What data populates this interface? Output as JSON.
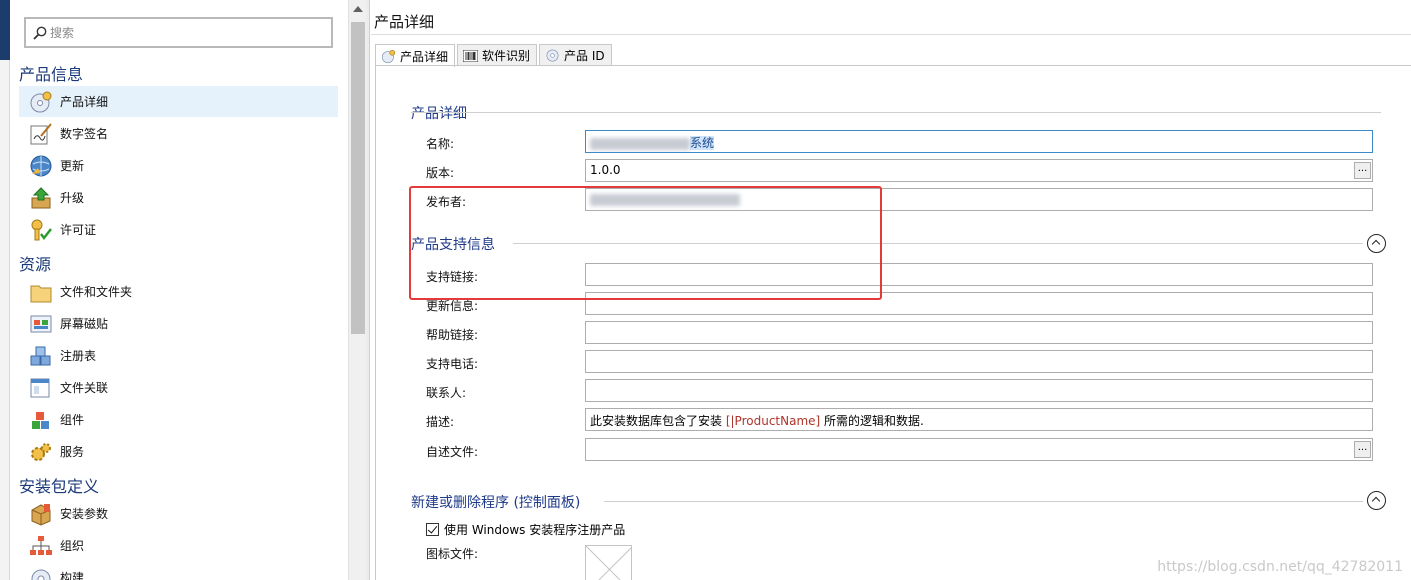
{
  "search": {
    "placeholder": "搜索"
  },
  "sidebar": {
    "groups": [
      {
        "title": "产品信息",
        "items": [
          "产品详细",
          "数字签名",
          "更新",
          "升级",
          "许可证"
        ]
      },
      {
        "title": "资源",
        "items": [
          "文件和文件夹",
          "屏幕磁贴",
          "注册表",
          "文件关联",
          "组件",
          "服务"
        ]
      },
      {
        "title": "安装包定义",
        "items": [
          "安装参数",
          "组织",
          "构建"
        ]
      }
    ]
  },
  "main": {
    "title": "产品详细",
    "tabs": [
      "产品详细",
      "软件识别",
      "产品 ID"
    ],
    "sections": {
      "details": {
        "title": "产品详细",
        "name_label": "名称:",
        "name_suffix": "系统",
        "version_label": "版本:",
        "version_value": "1.0.0",
        "publisher_label": "发布者:"
      },
      "support": {
        "title": "产品支持信息",
        "fields": [
          {
            "label": "支持链接:",
            "value": ""
          },
          {
            "label": "更新信息:",
            "value": ""
          },
          {
            "label": "帮助链接:",
            "value": ""
          },
          {
            "label": "支持电话:",
            "value": ""
          },
          {
            "label": "联系人:",
            "value": ""
          }
        ],
        "description_label": "描述:",
        "description_prefix": "此安装数据库包含了安装 ",
        "description_token": "[|ProductName]",
        "description_suffix": " 所需的逻辑和数据.",
        "readme_label": "自述文件:"
      },
      "arp": {
        "title": "新建或删除程序 (控制面板)",
        "checkbox_label": "使用 Windows 安装程序注册产品",
        "checkbox_checked": true,
        "icon_label": "图标文件:"
      }
    },
    "ellipsis": "..."
  },
  "watermark": "https://blog.csdn.net/qq_42782011",
  "colors": {
    "accent": "#1e3a8a",
    "highlight_box": "#e23b3b",
    "selected_bg": "#e5f1fb"
  }
}
